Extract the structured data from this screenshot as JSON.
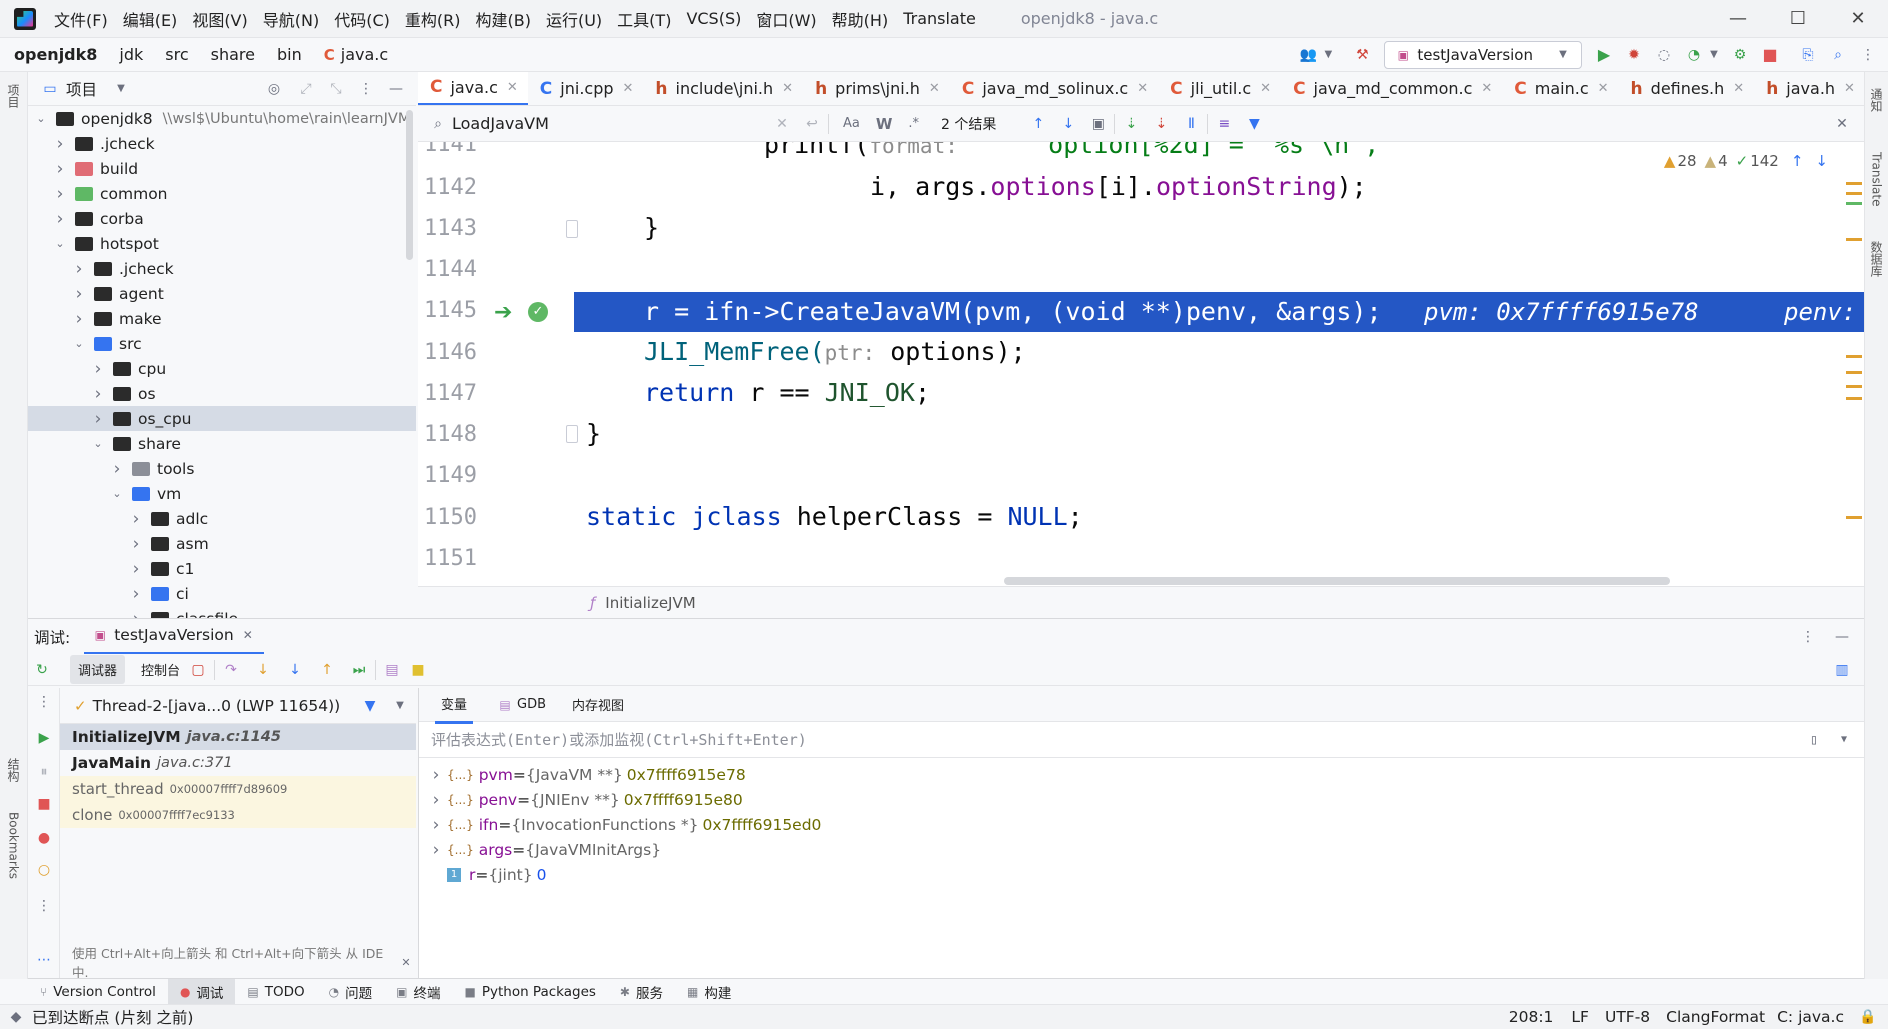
{
  "menubar": {
    "items": [
      "文件(F)",
      "编辑(E)",
      "视图(V)",
      "导航(N)",
      "代码(C)",
      "重构(R)",
      "构建(B)",
      "运行(U)",
      "工具(T)",
      "VCS(S)",
      "窗口(W)",
      "帮助(H)",
      "Translate"
    ],
    "window_title": "openjdk8 - java.c"
  },
  "navbar": {
    "crumbs": [
      "openjdk8",
      "jdk",
      "src",
      "share",
      "bin",
      "java.c"
    ],
    "run_config": "testJavaVersion"
  },
  "project": {
    "title": "项目",
    "tree": [
      {
        "label": "openjdk8",
        "extra": "\\\\wsl$\\Ubuntu\\home\\rain\\learnJVM",
        "indent": 0,
        "arrow": "down",
        "kind": "dark"
      },
      {
        "label": ".jcheck",
        "indent": 1,
        "arrow": "right",
        "kind": "dark"
      },
      {
        "label": "build",
        "indent": 1,
        "arrow": "right",
        "kind": "red"
      },
      {
        "label": "common",
        "indent": 1,
        "arrow": "right",
        "kind": "grn"
      },
      {
        "label": "corba",
        "indent": 1,
        "arrow": "right",
        "kind": "dark"
      },
      {
        "label": "hotspot",
        "indent": 1,
        "arrow": "down",
        "kind": "dark"
      },
      {
        "label": ".jcheck",
        "indent": 2,
        "arrow": "right",
        "kind": "dark"
      },
      {
        "label": "agent",
        "indent": 2,
        "arrow": "right",
        "kind": "dark"
      },
      {
        "label": "make",
        "indent": 2,
        "arrow": "right",
        "kind": "dark"
      },
      {
        "label": "src",
        "indent": 2,
        "arrow": "down",
        "kind": "mod"
      },
      {
        "label": "cpu",
        "indent": 3,
        "arrow": "right",
        "kind": "dark"
      },
      {
        "label": "os",
        "indent": 3,
        "arrow": "right",
        "kind": "dark"
      },
      {
        "label": "os_cpu",
        "indent": 3,
        "arrow": "right",
        "kind": "dark",
        "selected": true
      },
      {
        "label": "share",
        "indent": 3,
        "arrow": "down",
        "kind": "dark"
      },
      {
        "label": "tools",
        "indent": 4,
        "arrow": "right",
        "kind": "gry"
      },
      {
        "label": "vm",
        "indent": 4,
        "arrow": "down",
        "kind": "mod"
      },
      {
        "label": "adlc",
        "indent": 5,
        "arrow": "right",
        "kind": "dark"
      },
      {
        "label": "asm",
        "indent": 5,
        "arrow": "right",
        "kind": "dark"
      },
      {
        "label": "c1",
        "indent": 5,
        "arrow": "right",
        "kind": "dark"
      },
      {
        "label": "ci",
        "indent": 5,
        "arrow": "right",
        "kind": "mod"
      },
      {
        "label": "classfile",
        "indent": 5,
        "arrow": "right",
        "kind": "dark"
      }
    ]
  },
  "tabs": [
    {
      "label": "java.c",
      "type": "C",
      "active": true
    },
    {
      "label": "jni.cpp",
      "type": "C"
    },
    {
      "label": "include\\jni.h",
      "type": "h"
    },
    {
      "label": "prims\\jni.h",
      "type": "h"
    },
    {
      "label": "java_md_solinux.c",
      "type": "C"
    },
    {
      "label": "jli_util.c",
      "type": "C"
    },
    {
      "label": "java_md_common.c",
      "type": "C"
    },
    {
      "label": "main.c",
      "type": "C"
    },
    {
      "label": "defines.h",
      "type": "h"
    },
    {
      "label": "java.h",
      "type": "h"
    }
  ],
  "search": {
    "query": "LoadJavaVM",
    "case_label": "Aa",
    "word_label": "W",
    "regex_label": ".*",
    "results": "2 个结果"
  },
  "editor": {
    "lines": [
      "1141",
      "1142",
      "1143",
      "1144",
      "1145",
      "1146",
      "1147",
      "1148",
      "1149",
      "1150",
      "1151"
    ],
    "inspections": {
      "warnings": "28",
      "weak": "4",
      "typos": "142"
    },
    "code": {
      "l1141_a": "printf(",
      "l1141_hint": "format:",
      "l1141_b": " \"    option[%2d] = '%s'\\n\",",
      "l1142_a": "i, args.",
      "l1142_b": "options",
      "l1142_c": "[i].",
      "l1142_d": "optionString",
      "l1142_e": ");",
      "l1143": "}",
      "l1145": "r = ifn->CreateJavaVM(pvm, (void **)penv, &args);",
      "l1145_inline1": "pvm: 0x7ffff6915e78",
      "l1145_inline2": "penv:",
      "l1146_a": "JLI_MemFree(",
      "l1146_hint": "ptr:",
      "l1146_b": " options);",
      "l1147_a": "return",
      "l1147_b": " r == ",
      "l1147_c": "JNI_OK",
      "l1147_d": ";",
      "l1148": "}",
      "l1150_a": "static",
      "l1150_b": " jclass",
      "l1150_c": " helperClass = ",
      "l1150_d": "NULL",
      "l1150_e": ";"
    },
    "breadcrumb": "InitializeJVM"
  },
  "debug": {
    "title": "调试:",
    "session": "testJavaVersion",
    "tab_debugger": "调试器",
    "tab_console": "控制台",
    "thread": "Thread-2-[java...0 (LWP 11654))",
    "frames": [
      {
        "name": "InitializeJVM",
        "loc": "java.c:1145",
        "style": "sel"
      },
      {
        "name": "JavaMain",
        "loc": "java.c:371",
        "style": "normal"
      },
      {
        "name": "start_thread",
        "loc": "0x00007ffff7d89609",
        "style": "lib"
      },
      {
        "name": "clone",
        "loc": "0x00007ffff7ec9133",
        "style": "lib"
      }
    ],
    "frames_hint": "使用 Ctrl+Alt+向上箭头 和 Ctrl+Alt+向下箭头 从 IDE 中.",
    "var_tabs": [
      "变量",
      "GDB",
      "内存视图"
    ],
    "eval_placeholder": "评估表达式(Enter)或添加监视(Ctrl+Shift+Enter)",
    "vars": [
      {
        "name": "pvm",
        "type": "{JavaVM **}",
        "value": "0x7ffff6915e78",
        "expandable": true
      },
      {
        "name": "penv",
        "type": "{JNIEnv **}",
        "value": "0x7ffff6915e80",
        "expandable": true
      },
      {
        "name": "ifn",
        "type": "{InvocationFunctions *}",
        "value": "0x7ffff6915ed0",
        "expandable": true
      },
      {
        "name": "args",
        "type": "{JavaVMInitArgs}",
        "value": "",
        "expandable": true
      },
      {
        "name": "r",
        "type": "{jint}",
        "value": "0",
        "expandable": false
      }
    ]
  },
  "leftstrip": {
    "project": "项目",
    "structure": "结构",
    "bookmarks": "Bookmarks"
  },
  "rightstrip": {
    "notifications": "通知",
    "translate": "Translate",
    "database": "数据库"
  },
  "toolwindows": [
    {
      "label": "Version Control",
      "icon": "⑂"
    },
    {
      "label": "调试",
      "icon": "●",
      "active": true
    },
    {
      "label": "TODO",
      "icon": "▤"
    },
    {
      "label": "问题",
      "icon": "◔"
    },
    {
      "label": "终端",
      "icon": "▣"
    },
    {
      "label": "Python Packages",
      "icon": "■"
    },
    {
      "label": "服务",
      "icon": "✱"
    },
    {
      "label": "构建",
      "icon": "▦"
    }
  ],
  "status": {
    "message": "已到达断点 (片刻 之前)",
    "position": "208:1",
    "line_sep": "LF",
    "encoding": "UTF-8",
    "formatter": "ClangFormat",
    "file": "C: java.c"
  }
}
